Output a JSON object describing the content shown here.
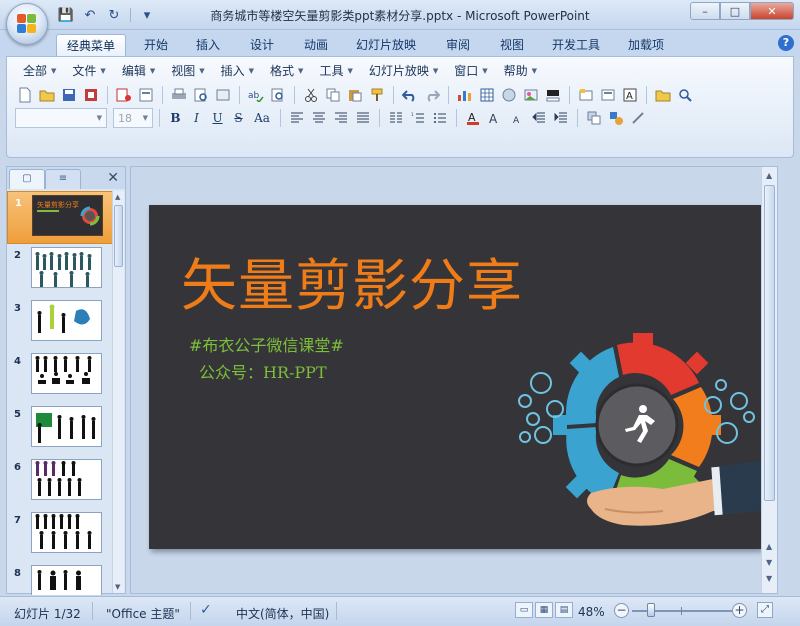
{
  "window": {
    "title": "商务城市等楼空矢量剪影类ppt素材分享.pptx - Microsoft PowerPoint",
    "controls": {
      "minimize": "–",
      "maximize": "□",
      "close": "✕"
    }
  },
  "qat": {
    "save": "💾",
    "undo": "↶",
    "redo": "↻",
    "customize": "▾"
  },
  "tabs": [
    "经典菜单",
    "开始",
    "插入",
    "设计",
    "动画",
    "幻灯片放映",
    "审阅",
    "视图",
    "开发工具",
    "加载项"
  ],
  "menus": [
    "全部",
    "文件",
    "编辑",
    "视图",
    "插入",
    "格式",
    "工具",
    "幻灯片放映",
    "窗口",
    "帮助"
  ],
  "font_size_value": "18",
  "format_buttons": {
    "bold": "B",
    "italic": "I",
    "underline": "U",
    "strike": "S",
    "case": "Aa"
  },
  "left_pane": {
    "tab_slides": "▢",
    "tab_outline": "≡",
    "close": "✕",
    "thumbnails": [
      {
        "num": "1",
        "title": "矢量剪影分享"
      },
      {
        "num": "2"
      },
      {
        "num": "3"
      },
      {
        "num": "4"
      },
      {
        "num": "5"
      },
      {
        "num": "6"
      },
      {
        "num": "7"
      },
      {
        "num": "8"
      }
    ]
  },
  "slide": {
    "title": "矢量剪影分享",
    "subtitle1": "#布衣公子微信课堂#",
    "subtitle2": "公众号：HR-PPT"
  },
  "statusbar": {
    "slide_counter": "幻灯片 1/32",
    "theme": "\"Office 主题\"",
    "language": "中文(简体，中国)",
    "zoom": "48%"
  },
  "colors": {
    "accent": "#f07c18",
    "subtitle": "#7bbf3a",
    "slide_bg": "#353539"
  }
}
